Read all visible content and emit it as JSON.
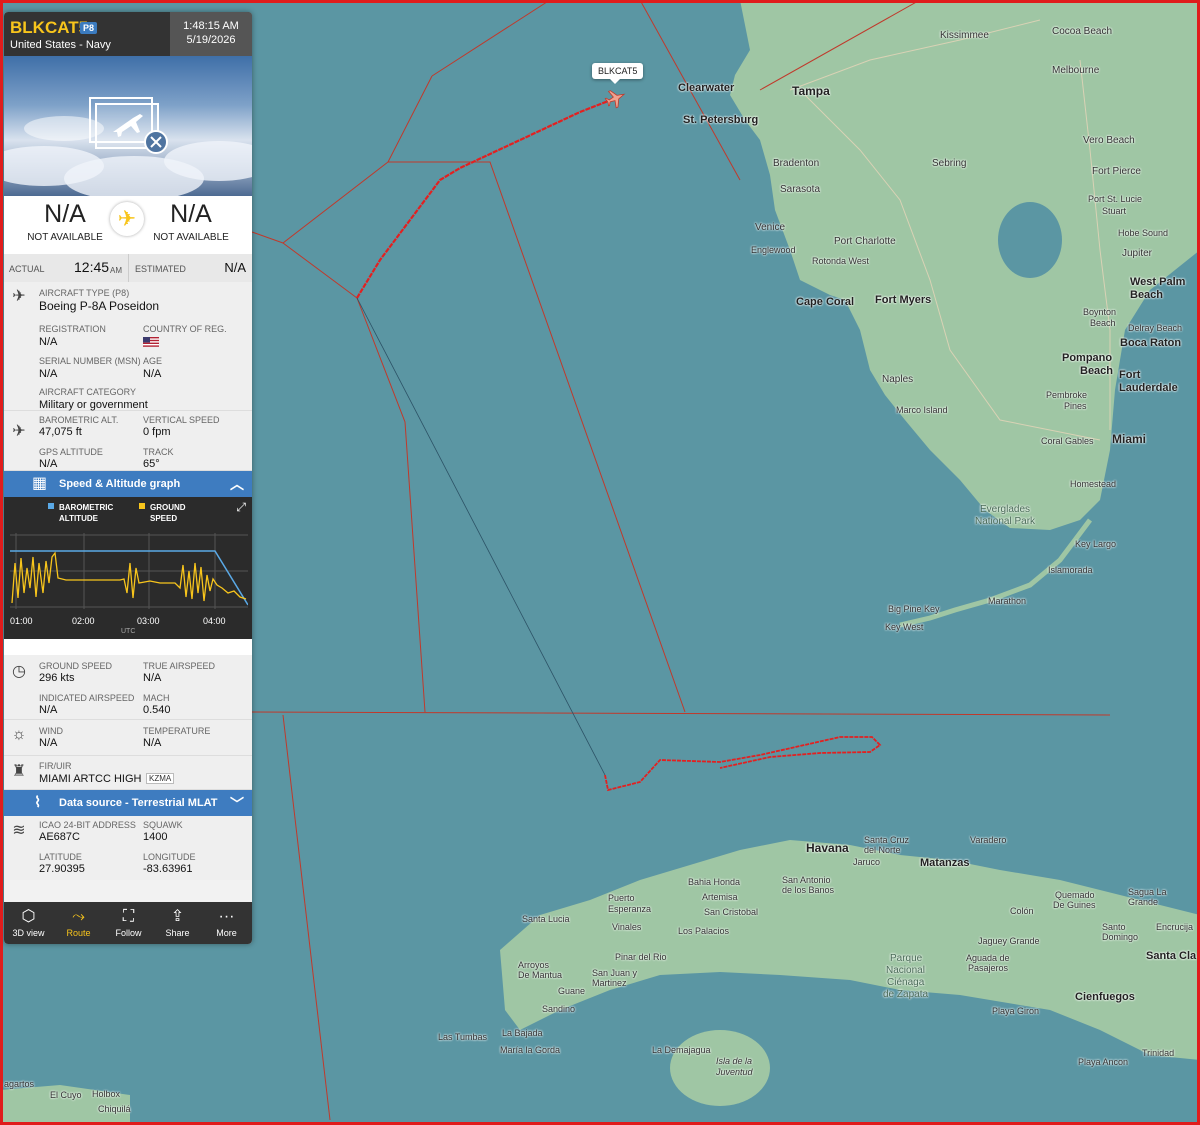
{
  "flight": {
    "callsign": "BLKCAT5",
    "type_badge": "P8",
    "operator": "United States - Navy",
    "time": "1:48:15 AM",
    "date": "5/19/2026"
  },
  "route": {
    "origin": "N/A",
    "origin_sub": "NOT AVAILABLE",
    "destination": "N/A",
    "destination_sub": "NOT AVAILABLE",
    "actual_label": "ACTUAL",
    "actual_time": "12:45",
    "actual_ampm": "AM",
    "estimated_label": "ESTIMATED",
    "estimated_time": "N/A"
  },
  "aircraft": {
    "type_label": "AIRCRAFT TYPE (P8)",
    "type_value": "Boeing P-8A Poseidon",
    "registration_label": "REGISTRATION",
    "registration_value": "N/A",
    "country_label": "COUNTRY OF REG.",
    "serial_label": "SERIAL NUMBER (MSN)",
    "serial_value": "N/A",
    "age_label": "AGE",
    "age_value": "N/A",
    "category_label": "AIRCRAFT CATEGORY",
    "category_value": "Military or government"
  },
  "altitude": {
    "baro_label": "BAROMETRIC ALT.",
    "baro_value": "47,075 ft",
    "vs_label": "VERTICAL SPEED",
    "vs_value": "0 fpm",
    "gps_label": "GPS ALTITUDE",
    "gps_value": "N/A",
    "track_label": "TRACK",
    "track_value": "65°"
  },
  "graph": {
    "title": "Speed & Altitude graph",
    "legend_alt": "BAROMETRIC\nALTITUDE",
    "legend_alt_1": "BAROMETRIC",
    "legend_alt_2": "ALTITUDE",
    "legend_speed_1": "GROUND",
    "legend_speed_2": "SPEED",
    "ticks": [
      "01:00",
      "02:00",
      "03:00",
      "04:00"
    ],
    "axis_unit": "UTC",
    "alt_color": "#5aa9e6",
    "speed_color": "#f8c51c"
  },
  "speed": {
    "gs_label": "GROUND SPEED",
    "gs_value": "296 kts",
    "tas_label": "TRUE AIRSPEED",
    "tas_value": "N/A",
    "ias_label": "INDICATED AIRSPEED",
    "ias_value": "N/A",
    "mach_label": "MACH",
    "mach_value": "0.540"
  },
  "weather": {
    "wind_label": "WIND",
    "wind_value": "N/A",
    "temp_label": "TEMPERATURE",
    "temp_value": "N/A"
  },
  "fir": {
    "label": "FIR/UIR",
    "value": "MIAMI ARTCC HIGH",
    "code": "KZMA"
  },
  "source": {
    "title": "Data source - Terrestrial MLAT"
  },
  "transponder": {
    "icao_label": "ICAO 24-BIT ADDRESS",
    "icao_value": "AE687C",
    "squawk_label": "SQUAWK",
    "squawk_value": "1400",
    "lat_label": "LATITUDE",
    "lat_value": "27.90395",
    "lon_label": "LONGITUDE",
    "lon_value": "-83.63961"
  },
  "toolbar": {
    "view3d": "3D view",
    "route": "Route",
    "follow": "Follow",
    "share": "Share",
    "more": "More"
  },
  "map": {
    "callout": "BLKCAT5",
    "labels": {
      "kissimmee": "Kissimmee",
      "cocoa_beach": "Cocoa Beach",
      "melbourne": "Melbourne",
      "clearwater": "Clearwater",
      "tampa": "Tampa",
      "st_petersburg": "St. Petersburg",
      "vero_beach": "Vero Beach",
      "bradenton": "Bradenton",
      "sebring": "Sebring",
      "fort_pierce": "Fort Pierce",
      "sarasota": "Sarasota",
      "port_st_lucie": "Port St. Lucie",
      "stuart": "Stuart",
      "venice": "Venice",
      "hobe_sound": "Hobe Sound",
      "port_charlotte": "Port Charlotte",
      "englewood": "Englewood",
      "jupiter": "Jupiter",
      "rotonda_west": "Rotonda West",
      "west_palm_1": "West Palm",
      "west_palm_2": "Beach",
      "cape_coral": "Cape Coral",
      "fort_myers": "Fort Myers",
      "boynton_1": "Boynton",
      "boynton_2": "Beach",
      "delray_beach": "Delray Beach",
      "boca_raton": "Boca Raton",
      "pompano_1": "Pompano",
      "pompano_2": "Beach",
      "fort_laud_1": "Fort",
      "fort_laud_2": "Lauderdale",
      "naples": "Naples",
      "pembroke_1": "Pembroke",
      "pembroke_2": "Pines",
      "marco_island": "Marco Island",
      "coral_gables": "Coral Gables",
      "miami": "Miami",
      "homestead": "Homestead",
      "everglades_1": "Everglades",
      "everglades_2": "National Park",
      "key_largo": "Key Largo",
      "islamorada": "Islamorada",
      "marathon": "Marathon",
      "big_pine_key": "Big Pine Key",
      "key_west": "Key West",
      "havana": "Havana",
      "santa_cruz_1": "Santa Cruz",
      "santa_cruz_2": "del Norte",
      "varadero": "Varadero",
      "jaruco": "Jaruco",
      "matanzas": "Matanzas",
      "bahia_honda": "Bahia Honda",
      "artemisa": "Artemisa",
      "san_antonio_1": "San Antonio",
      "san_antonio_2": "de los Banos",
      "puerto_1": "Puerto",
      "puerto_2": "Esperanza",
      "san_cristobal": "San Cristobal",
      "santa_lucia": "Santa Lucia",
      "vinales": "Vinales",
      "los_palacios": "Los Palacios",
      "quemado_1": "Quemado",
      "quemado_2": "De Guines",
      "sagua_1": "Sagua La",
      "sagua_2": "Grande",
      "colon": "Colón",
      "santo_1": "Santo",
      "santo_2": "Domingo",
      "encrucija": "Encrucija",
      "jaguey": "Jaguey Grande",
      "pinar": "Pinar del Rio",
      "arroyos_1": "Arroyos",
      "arroyos_2": "De Mantua",
      "san_juan_1": "San Juan y",
      "san_juan_2": "Martinez",
      "parque_1": "Parque",
      "parque_2": "Nacional",
      "parque_3": "Ciénaga",
      "parque_4": "de Zapata",
      "aguada_1": "Aguada de",
      "aguada_2": "Pasajeros",
      "santa_clara": "Santa Cla",
      "cienfuegos": "Cienfuegos",
      "guane": "Guane",
      "sandino": "Sandino",
      "playa_giron": "Playa Giron",
      "las_tumbas": "Las Tumbas",
      "la_bajada": "La Bajada",
      "maria_la_gorda": "María la Gorda",
      "la_demajagua": "La Demajagua",
      "isla_1": "Isla de la",
      "isla_2": "Juventud",
      "trinidad": "Trinidad",
      "playa_ancon": "Playa Ancon",
      "agartos": "agartos",
      "el_cuyo": "El Cuyo",
      "holbox": "Holbox",
      "chiquila": "Chiquilá"
    }
  }
}
